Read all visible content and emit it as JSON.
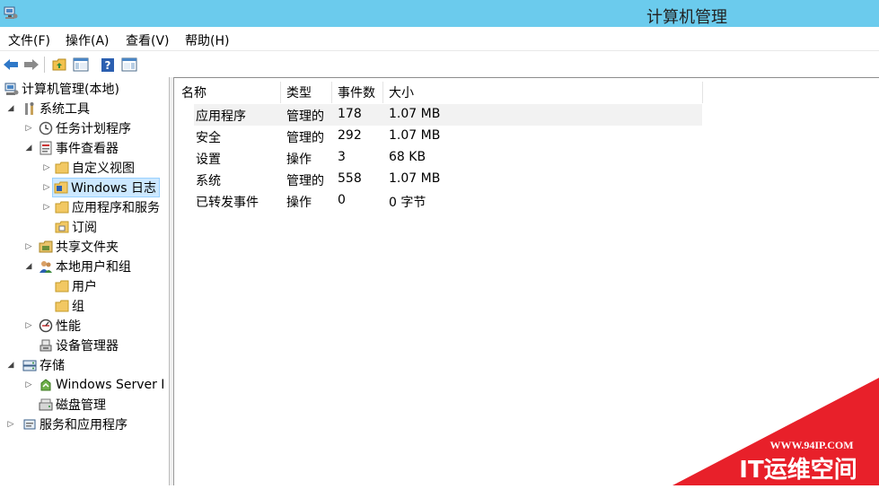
{
  "window": {
    "title": "计算机管理"
  },
  "menu": {
    "file": "文件(F)",
    "action": "操作(A)",
    "view": "查看(V)",
    "help": "帮助(H)"
  },
  "tree": {
    "root": "计算机管理(本地)",
    "system_tools": "系统工具",
    "task_scheduler": "任务计划程序",
    "event_viewer": "事件查看器",
    "custom_views": "自定义视图",
    "windows_logs": "Windows 日志",
    "app_service_logs": "应用程序和服务",
    "subscriptions": "订阅",
    "shared_folders": "共享文件夹",
    "local_users": "本地用户和组",
    "users": "用户",
    "groups": "组",
    "performance": "性能",
    "device_manager": "设备管理器",
    "storage": "存储",
    "windows_server_backup": "Windows Server I",
    "disk_management": "磁盘管理",
    "services_apps": "服务和应用程序"
  },
  "list": {
    "columns": [
      "名称",
      "类型",
      "事件数",
      "大小"
    ],
    "rows": [
      [
        "应用程序",
        "管理的",
        "178",
        "1.07 MB"
      ],
      [
        "安全",
        "管理的",
        "292",
        "1.07 MB"
      ],
      [
        "设置",
        "操作",
        "3",
        "68 KB"
      ],
      [
        "系统",
        "管理的",
        "558",
        "1.07 MB"
      ],
      [
        "已转发事件",
        "操作",
        "0",
        "0 字节"
      ]
    ]
  },
  "watermark": {
    "url": "WWW.94IP.COM",
    "text": "IT运维空间"
  },
  "colors": {
    "titlebar": "#6bcbed",
    "selection": "#cce8ff",
    "watermark": "#e8202a"
  }
}
